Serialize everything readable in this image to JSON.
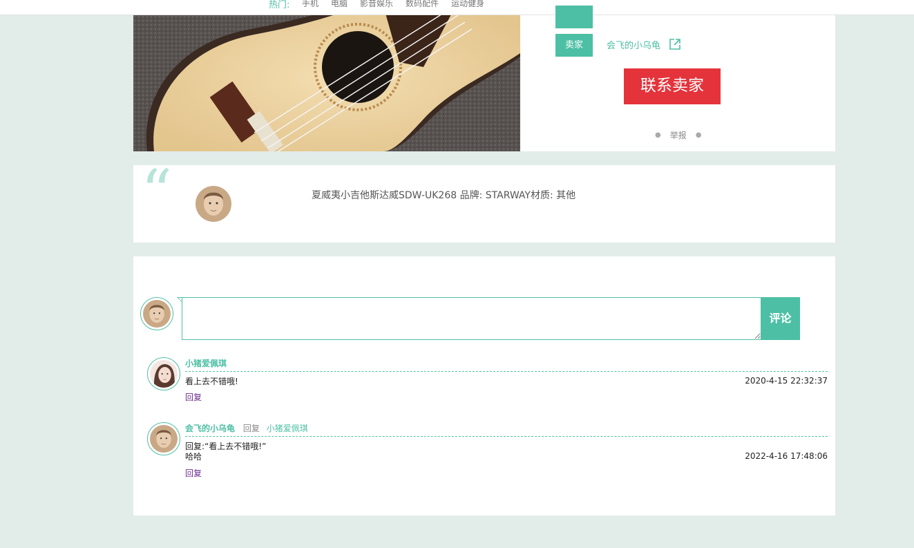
{
  "nav": {
    "hot_label": "热门:",
    "categories": [
      "手机",
      "电脑",
      "影音娱乐",
      "数码配件",
      "运动健身"
    ]
  },
  "product": {
    "seller_label": "卖家",
    "seller_name": "会飞的小乌龟",
    "contact_button": "联系卖家",
    "report_link": "举报",
    "description": "夏威夷小吉他斯达威SDW-UK268 品牌: STARWAY材质: 其他"
  },
  "comment_form": {
    "input_value": "",
    "submit_label": "评论"
  },
  "comments": [
    {
      "author": "小猪爱佩琪",
      "text_lines": [
        "看上去不错哦!"
      ],
      "time": "2020-4-15 22:32:37",
      "reply_label": "回复"
    },
    {
      "author": "会飞的小乌龟",
      "reply_word": "回复",
      "reply_to": "小猪爱佩琪",
      "text_lines": [
        "回复:“看上去不错哦!”",
        "哈哈"
      ],
      "time": "2022-4-16 17:48:06",
      "reply_label": "回复"
    }
  ],
  "colors": {
    "accent": "#4cbfa4",
    "contact": "#e4333b",
    "background": "#e2ece9",
    "reply_link": "#6b2d8f"
  },
  "icons": [
    "external-link-icon",
    "quote-icon",
    "avatar-male-icon",
    "avatar-female-icon"
  ]
}
